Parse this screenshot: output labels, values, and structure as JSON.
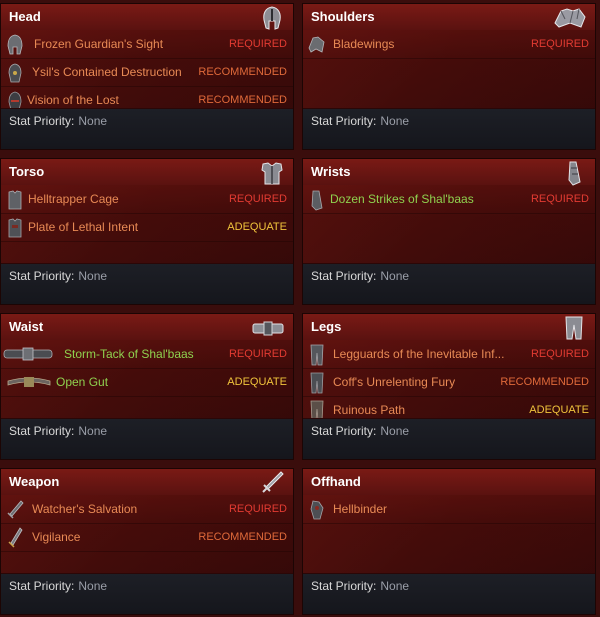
{
  "colors": {
    "required": "#e23b32",
    "recommended": "#e06a3a",
    "adequate": "#f0c43c",
    "item_orange": "#e88a55",
    "item_green": "#8fd14f"
  },
  "slots": [
    {
      "title": "Head",
      "icon": "helmet-icon",
      "items": [
        {
          "name": "Frozen Guardian's Sight",
          "tier": "REQUIRED",
          "icon": "helmet-icon"
        },
        {
          "name": "Ysil's Contained Destruction",
          "tier": "RECOMMENDED",
          "icon": "helmet-icon"
        },
        {
          "name": "Vision of the Lost",
          "tier": "RECOMMENDED",
          "icon": "helmet-icon"
        }
      ],
      "stat_label": "Stat Priority:",
      "stat_value": "None"
    },
    {
      "title": "Shoulders",
      "icon": "shoulder-icon",
      "items": [
        {
          "name": "Bladewings",
          "tier": "REQUIRED",
          "icon": "shoulder-icon"
        }
      ],
      "stat_label": "Stat Priority:",
      "stat_value": "None"
    },
    {
      "title": "Torso",
      "icon": "chest-armor-icon",
      "items": [
        {
          "name": "Helltrapper Cage",
          "tier": "REQUIRED",
          "icon": "chest-armor-icon"
        },
        {
          "name": "Plate of Lethal Intent",
          "tier": "ADEQUATE",
          "icon": "chest-armor-icon"
        }
      ],
      "stat_label": "Stat Priority:",
      "stat_value": "None"
    },
    {
      "title": "Wrists",
      "icon": "bracer-icon",
      "items": [
        {
          "name": "Dozen Strikes of Shal'baas",
          "tier": "REQUIRED",
          "icon": "bracer-icon",
          "color": "green"
        }
      ],
      "stat_label": "Stat Priority:",
      "stat_value": "None"
    },
    {
      "title": "Waist",
      "icon": "belt-icon",
      "items": [
        {
          "name": "Storm-Tack of Shal'baas",
          "tier": "REQUIRED",
          "icon": "belt-icon",
          "color": "green",
          "wide": true
        },
        {
          "name": "Open Gut",
          "tier": "ADEQUATE",
          "icon": "belt-icon",
          "color": "green",
          "mid": true
        }
      ],
      "stat_label": "Stat Priority:",
      "stat_value": "None"
    },
    {
      "title": "Legs",
      "icon": "leggings-icon",
      "items": [
        {
          "name": "Legguards of the Inevitable Inf...",
          "tier": "REQUIRED",
          "icon": "leggings-icon"
        },
        {
          "name": "Coff's Unrelenting Fury",
          "tier": "RECOMMENDED",
          "icon": "leggings-icon"
        },
        {
          "name": "Ruinous Path",
          "tier": "ADEQUATE",
          "icon": "leggings-icon"
        }
      ],
      "stat_label": "Stat Priority:",
      "stat_value": "None"
    },
    {
      "title": "Weapon",
      "icon": "sword-icon",
      "items": [
        {
          "name": "Watcher's Salvation",
          "tier": "REQUIRED",
          "icon": "sword-icon"
        },
        {
          "name": "Vigilance",
          "tier": "RECOMMENDED",
          "icon": "sword-icon"
        }
      ],
      "stat_label": "Stat Priority:",
      "stat_value": "None"
    },
    {
      "title": "Offhand",
      "icon": "offhand-icon",
      "items": [
        {
          "name": "Hellbinder",
          "tier": "",
          "icon": "offhand-icon"
        }
      ],
      "stat_label": "Stat Priority:",
      "stat_value": "None"
    }
  ]
}
